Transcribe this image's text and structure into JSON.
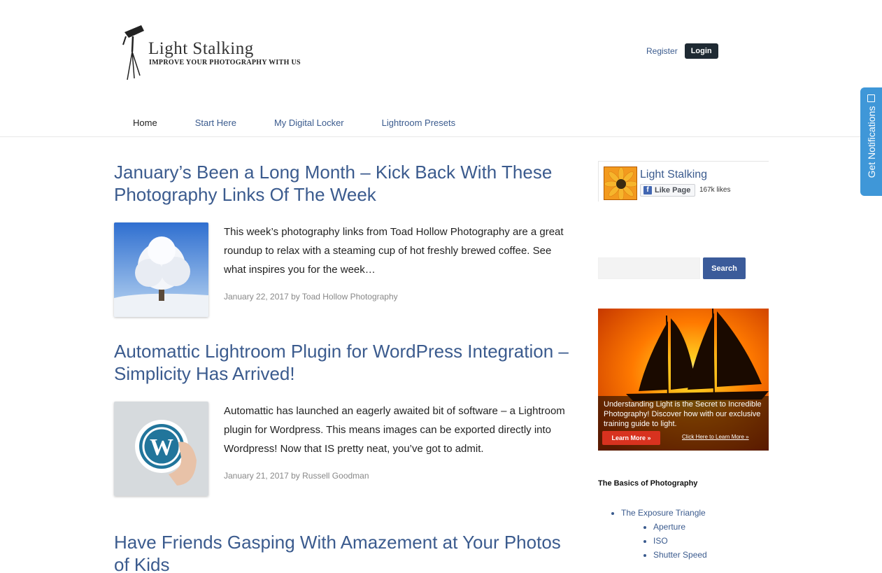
{
  "header": {
    "logo_title": "Light Stalking",
    "logo_tagline": "IMPROVE YOUR PHOTOGRAPHY WITH US",
    "register_label": "Register",
    "login_label": "Login"
  },
  "nav": {
    "items": [
      {
        "label": "Home"
      },
      {
        "label": "Start Here"
      },
      {
        "label": "My Digital Locker"
      },
      {
        "label": "Lightroom Presets"
      }
    ]
  },
  "posts": [
    {
      "title": "January’s Been a Long Month – Kick Back With These Photography Links Of The Week",
      "excerpt": "This week’s photography links from Toad Hollow Photography are a great roundup to relax with a steaming cup of hot freshly brewed coffee. See what inspires you for the week…",
      "date": "January 22, 2017",
      "by": "by",
      "author": "Toad Hollow Photography"
    },
    {
      "title": "Automattic Lightroom Plugin for WordPress Integration – Simplicity Has Arrived!",
      "excerpt": "Automattic has launched an eagerly awaited bit of software – a Lightroom plugin for Wordpress. This means images can be exported directly into Wordpress! Now that IS pretty neat, you’ve got to admit.",
      "date": "January 21, 2017",
      "by": "by",
      "author": "Russell Goodman"
    },
    {
      "title": "Have Friends Gasping With Amazement at Your Photos of Kids"
    }
  ],
  "sidebar": {
    "fb": {
      "page_name": "Light Stalking",
      "like_label": "Like Page",
      "likes": "167k likes"
    },
    "search": {
      "placeholder": "",
      "button_label": "Search"
    },
    "ad": {
      "text": "Understanding Light is the Secret to Incredible Photography! Discover how with our exclusive training guide to light.",
      "button_label": "Learn More »",
      "link_label": "Click Here to Learn More »"
    },
    "widget": {
      "title": "The Basics of Photography",
      "item": "The Exposure Triangle",
      "subitems": [
        "Aperture",
        "ISO",
        "Shutter Speed"
      ]
    }
  },
  "notifications": {
    "label": "Get Notifications"
  },
  "colors": {
    "link": "#3b5b8e",
    "login_bg": "#1f2a33",
    "search_btn": "#3b5b9a",
    "notif_tab": "#3f97d8"
  }
}
